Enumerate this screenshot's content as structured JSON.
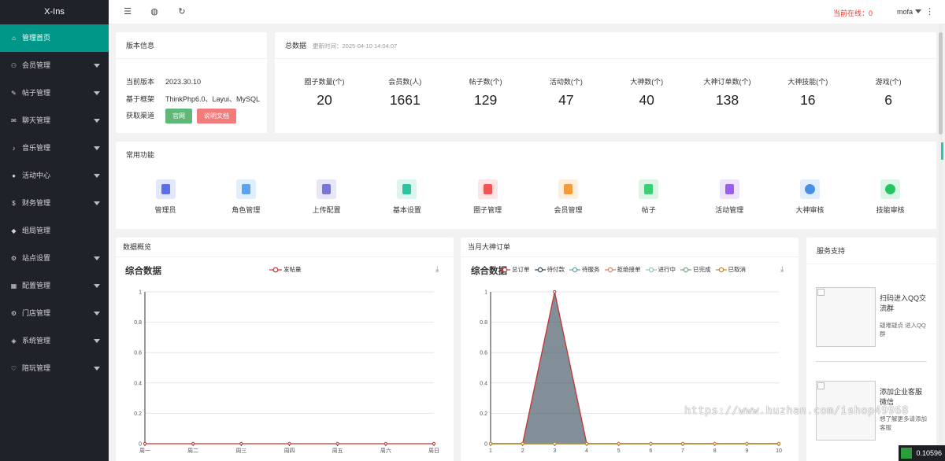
{
  "app": {
    "title": "X-Ins"
  },
  "sidebar": {
    "items": [
      {
        "label": "管理首页",
        "icon": "home-icon",
        "glyph": "⌂",
        "active": true,
        "caret": false
      },
      {
        "label": "会员管理",
        "icon": "user-icon",
        "glyph": "⚇",
        "active": false,
        "caret": true
      },
      {
        "label": "帖子管理",
        "icon": "post-icon",
        "glyph": "✎",
        "active": false,
        "caret": true
      },
      {
        "label": "聊天管理",
        "icon": "chat-icon",
        "glyph": "✉",
        "active": false,
        "caret": true
      },
      {
        "label": "音乐管理",
        "icon": "music-icon",
        "glyph": "♪",
        "active": false,
        "caret": true
      },
      {
        "label": "活动中心",
        "icon": "activity-icon",
        "glyph": "●",
        "active": false,
        "caret": true
      },
      {
        "label": "财务管理",
        "icon": "finance-icon",
        "glyph": "$",
        "active": false,
        "caret": true
      },
      {
        "label": "组局管理",
        "icon": "group-icon",
        "glyph": "◆",
        "active": false,
        "caret": false
      },
      {
        "label": "站点设置",
        "icon": "site-settings-icon",
        "glyph": "⚙",
        "active": false,
        "caret": true
      },
      {
        "label": "配置管理",
        "icon": "config-icon",
        "glyph": "▦",
        "active": false,
        "caret": true
      },
      {
        "label": "门店管理",
        "icon": "store-icon",
        "glyph": "⚙",
        "active": false,
        "caret": true
      },
      {
        "label": "系统管理",
        "icon": "system-icon",
        "glyph": "◈",
        "active": false,
        "caret": true
      },
      {
        "label": "陪玩管理",
        "icon": "companion-icon",
        "glyph": "♡",
        "active": false,
        "caret": true
      }
    ]
  },
  "header": {
    "icons": [
      {
        "name": "menu-fold-icon",
        "glyph": "☰"
      },
      {
        "name": "globe-icon",
        "glyph": "◍"
      },
      {
        "name": "refresh-icon",
        "glyph": "↻"
      }
    ],
    "online_text": "当前在线：0",
    "username": "mofa",
    "more_glyph": "⋮"
  },
  "version_card": {
    "title": "版本信息",
    "rows": [
      {
        "key": "当前版本",
        "value": "2023.30.10"
      },
      {
        "key": "基于框架",
        "value": "ThinkPhp6.0、Layui、MySQL"
      }
    ],
    "channel_label": "获取渠道",
    "buttons": [
      {
        "label": "官网",
        "color": "#5fb878"
      },
      {
        "label": "说明文档",
        "color": "#f27b7b"
      }
    ]
  },
  "totals_card": {
    "title": "总数据",
    "updated": "更新时间：2025-04-10 14:04:07",
    "stats": [
      {
        "label": "圈子数量(个)",
        "value": "20"
      },
      {
        "label": "会员数(人)",
        "value": "1661"
      },
      {
        "label": "帖子数(个)",
        "value": "129"
      },
      {
        "label": "活动数(个)",
        "value": "47"
      },
      {
        "label": "大神数(个)",
        "value": "40"
      },
      {
        "label": "大神订单数(个)",
        "value": "138"
      },
      {
        "label": "大神技能(个)",
        "value": "16"
      },
      {
        "label": "游戏(个)",
        "value": "6"
      }
    ]
  },
  "functions_card": {
    "title": "常用功能",
    "items": [
      {
        "label": "管理员",
        "icon": "admin-icon",
        "bg": "#e3e7fb",
        "fg": "#5a6fe8"
      },
      {
        "label": "角色管理",
        "icon": "role-icon",
        "bg": "#e1eefc",
        "fg": "#5ba3f2"
      },
      {
        "label": "上传配置",
        "icon": "upload-config-icon",
        "bg": "#e6e6f7",
        "fg": "#7a75d9"
      },
      {
        "label": "基本设置",
        "icon": "basic-settings-icon",
        "bg": "#dcf5ee",
        "fg": "#2ec4a0"
      },
      {
        "label": "圈子管理",
        "icon": "circle-icon",
        "bg": "#fde5e5",
        "fg": "#f05454"
      },
      {
        "label": "会员管理",
        "icon": "member-icon",
        "bg": "#fdeedd",
        "fg": "#f59a3c"
      },
      {
        "label": "帖子",
        "icon": "post-box-icon",
        "bg": "#dcf5e6",
        "fg": "#3ccf76"
      },
      {
        "label": "活动管理",
        "icon": "activity-manage-icon",
        "bg": "#ede3fb",
        "fg": "#9b5ff0"
      },
      {
        "label": "大神审核",
        "icon": "basketball-icon",
        "bg": "#e2eefc",
        "fg": "#4a90e2"
      },
      {
        "label": "技能审核",
        "icon": "p-badge-icon",
        "bg": "#dcf5e6",
        "fg": "#22c55e"
      }
    ]
  },
  "overview_card": {
    "title": "数据概览",
    "download_glyph": "⤓"
  },
  "orders_card": {
    "title": "当月大神订单",
    "download_glyph": "⤓"
  },
  "chart_data": [
    {
      "type": "line",
      "title": "综合数据",
      "categories": [
        "周一",
        "周二",
        "周三",
        "周四",
        "周五",
        "周六",
        "周日"
      ],
      "series": [
        {
          "name": "发帖量",
          "values": [
            0,
            0,
            0,
            0,
            0,
            0,
            0
          ],
          "color": "#c23531"
        }
      ],
      "yticks": [
        "0",
        "0.2",
        "0.4",
        "0.6",
        "0.8",
        "1"
      ],
      "ylim": [
        0,
        1
      ],
      "grid": true,
      "legend": "top"
    },
    {
      "type": "area",
      "title": "综合数据",
      "categories": [
        "1",
        "2",
        "3",
        "4",
        "5",
        "6",
        "7",
        "8",
        "9",
        "10"
      ],
      "series": [
        {
          "name": "总订单",
          "values": [
            0,
            0,
            1,
            0,
            0,
            0,
            0,
            0,
            0,
            0
          ],
          "color": "#c23531"
        },
        {
          "name": "待付款",
          "values": [
            0,
            0,
            0,
            0,
            0,
            0,
            0,
            0,
            0,
            0
          ],
          "color": "#2f4554"
        },
        {
          "name": "待服务",
          "values": [
            0,
            0,
            0,
            0,
            0,
            0,
            0,
            0,
            0,
            0
          ],
          "color": "#61a0a8"
        },
        {
          "name": "拒绝接单",
          "values": [
            0,
            0,
            0,
            0,
            0,
            0,
            0,
            0,
            0,
            0
          ],
          "color": "#d48265"
        },
        {
          "name": "进行中",
          "values": [
            0,
            0,
            0,
            0,
            0,
            0,
            0,
            0,
            0,
            0
          ],
          "color": "#91c7ae"
        },
        {
          "name": "已完成",
          "values": [
            0,
            0,
            0,
            0,
            0,
            0,
            0,
            0,
            0,
            0
          ],
          "color": "#749f83"
        },
        {
          "name": "已取消",
          "values": [
            0,
            0,
            0,
            0,
            0,
            0,
            0,
            0,
            0,
            0
          ],
          "color": "#ca8622"
        }
      ],
      "yticks": [
        "0",
        "0.2",
        "0.4",
        "0.6",
        "0.8",
        "1"
      ],
      "ylim": [
        0,
        1
      ],
      "grid": true,
      "legend": "top"
    }
  ],
  "support_card": {
    "title": "服务支持",
    "items": [
      {
        "title": "扫码进入QQ交流群",
        "desc": "疑难疑点 进入QQ群"
      },
      {
        "title": "添加企业客服微信",
        "desc": "想了解更多请添加客服"
      }
    ]
  },
  "watermark": "https://www.huzhan.com/ishop49968",
  "corner_badge": "0.10596"
}
